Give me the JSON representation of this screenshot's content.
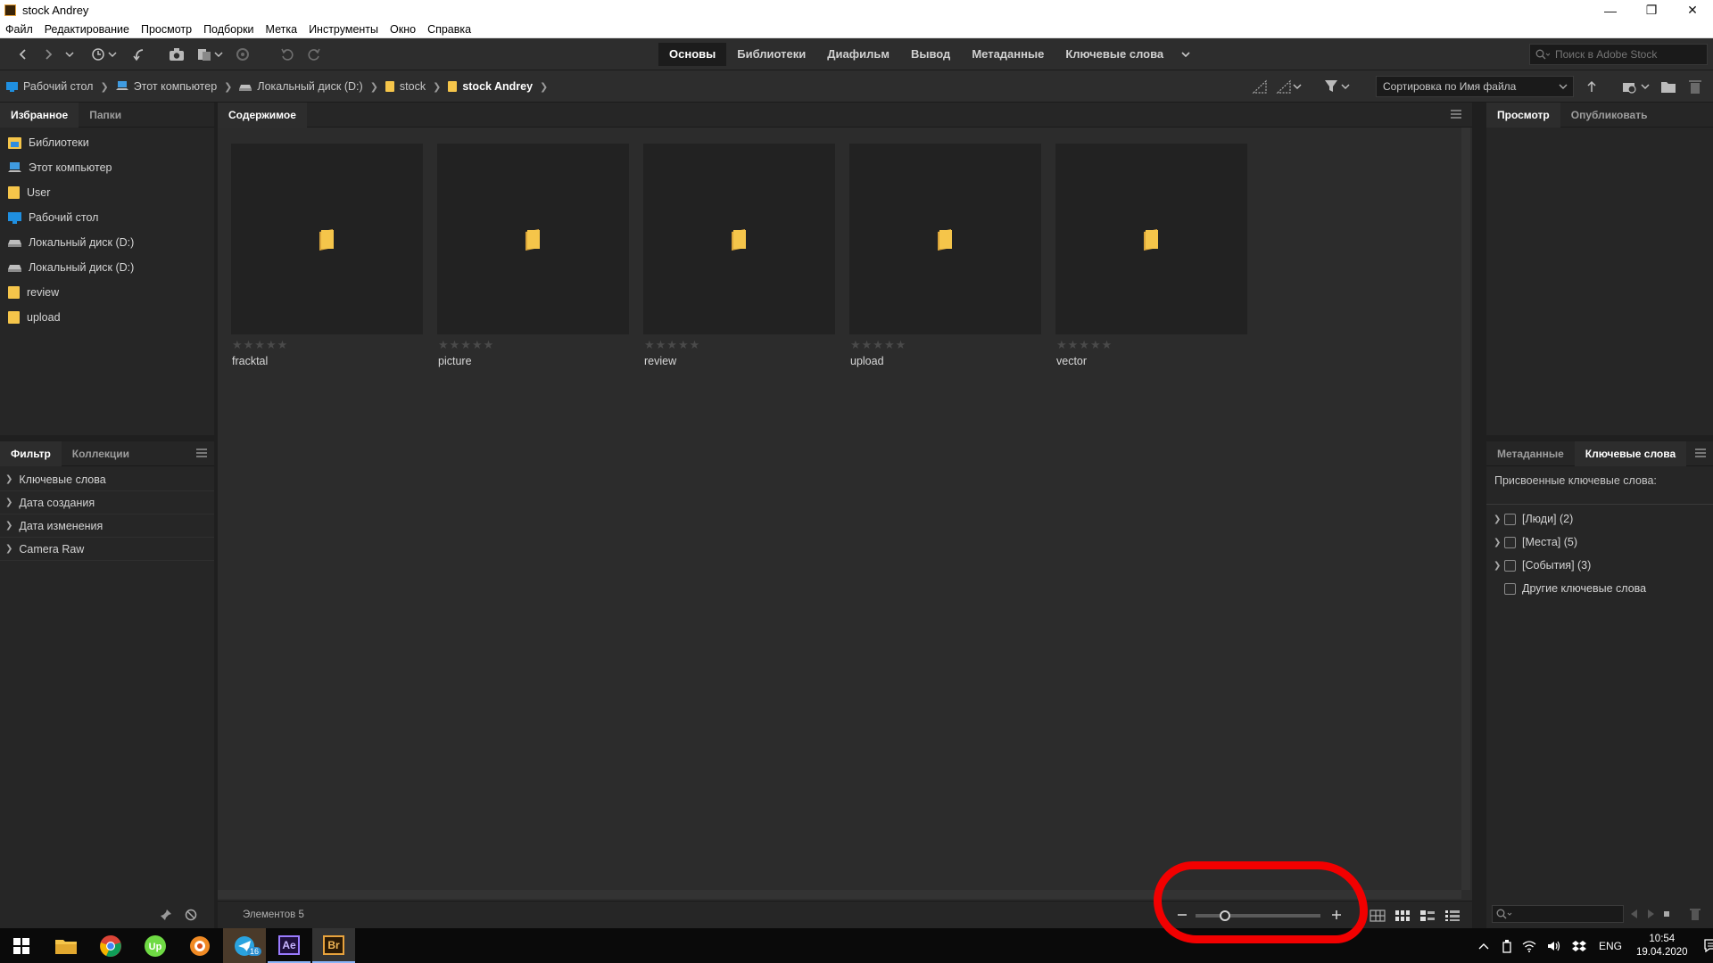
{
  "window": {
    "title": "stock Andrey",
    "minimize": "—",
    "restore": "❐",
    "close": "✕"
  },
  "menu": [
    "Файл",
    "Редактирование",
    "Просмотр",
    "Подборки",
    "Метка",
    "Инструменты",
    "Окно",
    "Справка"
  ],
  "workspaces": [
    {
      "label": "Основы",
      "active": true
    },
    {
      "label": "Библиотеки"
    },
    {
      "label": "Диафильм"
    },
    {
      "label": "Вывод"
    },
    {
      "label": "Метаданные"
    },
    {
      "label": "Ключевые слова"
    }
  ],
  "stock_search": {
    "placeholder": "Поиск в Adobe Stock"
  },
  "breadcrumb": [
    "Рабочий стол",
    "Этот компьютер",
    "Локальный диск (D:)",
    "stock",
    "stock Andrey"
  ],
  "sort": {
    "label": "Сортировка по Имя файла"
  },
  "left_tabs": {
    "favorites": "Избранное",
    "folders": "Папки"
  },
  "favorites": [
    {
      "label": "Библиотеки",
      "icon": "libraries-icon"
    },
    {
      "label": "Этот компьютер",
      "icon": "computer-icon"
    },
    {
      "label": "User",
      "icon": "folder-icon"
    },
    {
      "label": "Рабочий стол",
      "icon": "desktop-icon"
    },
    {
      "label": "Локальный диск (D:)",
      "icon": "drive-icon"
    },
    {
      "label": "Локальный диск (D:)",
      "icon": "drive-icon"
    },
    {
      "label": "review",
      "icon": "folder-icon"
    },
    {
      "label": "upload",
      "icon": "folder-icon"
    }
  ],
  "filter_tabs": {
    "filter": "Фильтр",
    "collections": "Коллекции"
  },
  "filters": [
    "Ключевые слова",
    "Дата создания",
    "Дата изменения",
    "Camera Raw"
  ],
  "content": {
    "tab": "Содержимое",
    "items": [
      {
        "name": "fracktal"
      },
      {
        "name": "picture"
      },
      {
        "name": "review"
      },
      {
        "name": "upload"
      },
      {
        "name": "vector"
      }
    ],
    "stars": "★★★★★",
    "status": "Элементов 5",
    "zoom_level": 0.25
  },
  "right_tabs": {
    "preview": "Просмотр",
    "publish": "Опубликовать"
  },
  "meta_tabs": {
    "metadata": "Метаданные",
    "keywords": "Ключевые слова"
  },
  "keywords": {
    "assigned_label": "Присвоенные ключевые слова:",
    "rows": [
      {
        "label": "[Люди] (2)",
        "expandable": true
      },
      {
        "label": "[Места] (5)",
        "expandable": true
      },
      {
        "label": "[События] (3)",
        "expandable": true
      },
      {
        "label": "Другие ключевые слова",
        "expandable": false
      }
    ]
  },
  "taskbar": {
    "telegram_badge": "16",
    "ae_label": "Ae",
    "br_label": "Br",
    "lang": "ENG",
    "time": "10:54",
    "date": "19.04.2020",
    "upwork": "Up"
  },
  "colors": {
    "folder": "#f5c54a",
    "panel": "#262626",
    "content": "#2c2c2c",
    "highlight": "#f20000"
  }
}
